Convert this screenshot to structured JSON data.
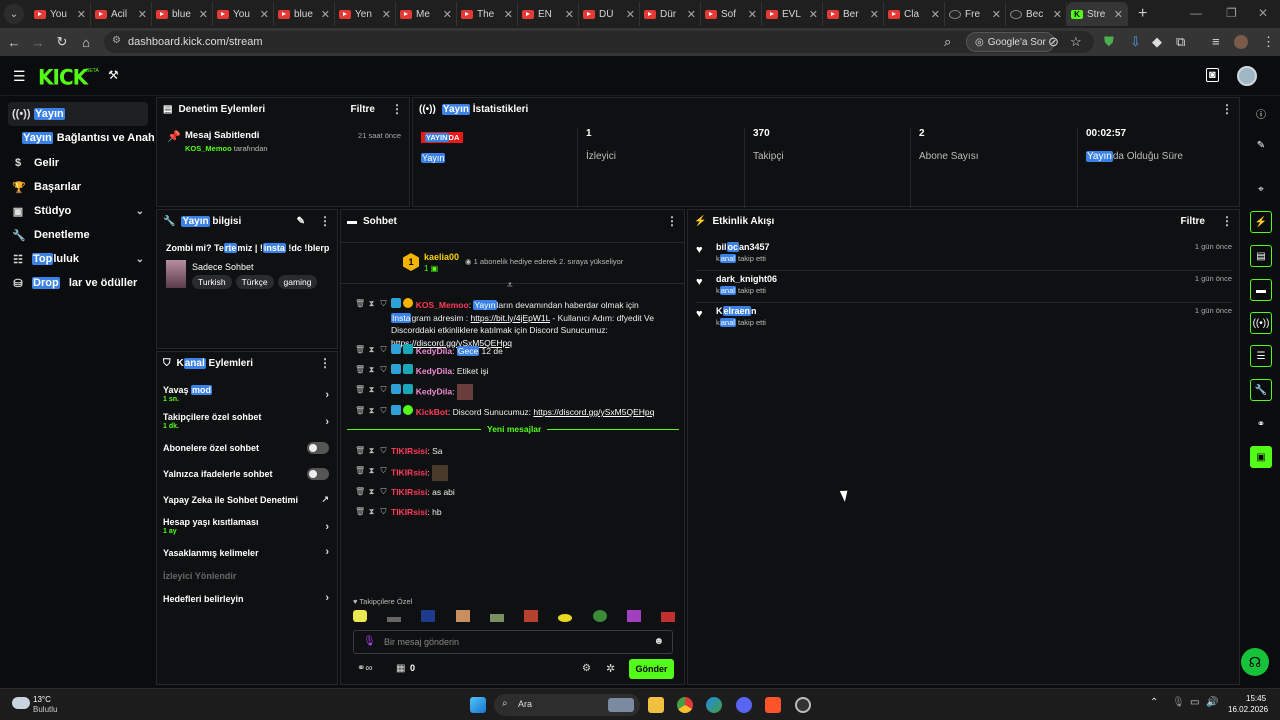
{
  "browser": {
    "tabs": [
      {
        "title": "You",
        "type": "yt"
      },
      {
        "title": "Acil",
        "type": "yt"
      },
      {
        "title": "blue",
        "type": "yt"
      },
      {
        "title": "You",
        "type": "yt"
      },
      {
        "title": "blue",
        "type": "yt"
      },
      {
        "title": "Yen",
        "type": "yt"
      },
      {
        "title": "Me",
        "type": "yt"
      },
      {
        "title": "The",
        "type": "yt"
      },
      {
        "title": "EN",
        "type": "yt"
      },
      {
        "title": "DÜ",
        "type": "yt"
      },
      {
        "title": "Dür",
        "type": "yt"
      },
      {
        "title": "Sof",
        "type": "yt"
      },
      {
        "title": "EVL",
        "type": "yt"
      },
      {
        "title": "Ber",
        "type": "yt"
      },
      {
        "title": "Cla",
        "type": "yt"
      },
      {
        "title": "Fre",
        "type": "dark"
      },
      {
        "title": "Bec",
        "type": "dark"
      },
      {
        "title": "Stre",
        "type": "kick",
        "active": true
      }
    ],
    "url": "dashboard.kick.com/stream",
    "google_sor": "Google'a Sor"
  },
  "kick": {
    "logo": "KICK",
    "beta": "BETA"
  },
  "leftnav": {
    "yayin": "Yayın",
    "baglanti_hl": "Yayın",
    "baglanti_rest": "Bağlantısı ve Anahtar",
    "gelir": "Gelir",
    "basarilar": "Başarılar",
    "studyo": "Stüdyo",
    "denetleme": "Denetleme",
    "topluluk_hl": "Top",
    "topluluk_rest": "luluk",
    "drops_hl": "Drop",
    "drops_rest": "lar ve ödüller"
  },
  "mod_actions": {
    "title": "Denetim Eylemleri",
    "filter": "Filtre",
    "item_title": "Mesaj Sabitlendi",
    "item_user": "KOS_Memoo",
    "item_by": "tarafından",
    "item_time": "21 saat önce"
  },
  "stats": {
    "title_hl": "Yayın",
    "title_rest": " İstatistikleri",
    "live_hl": "YAYIN",
    "live_rest": "DA",
    "yayin_hl": "Yayın",
    "viewers_v": "1",
    "viewers_l": "İzleyici",
    "followers_v": "370",
    "followers_l": "Takipçi",
    "subs_v": "2",
    "subs_l": "Abone Sayısı",
    "uptime_v": "00:02:57",
    "uptime_hl": "Yayın",
    "uptime_rest": "da Olduğu Süre"
  },
  "stream_info": {
    "title_hl": "Yayın",
    "title_rest": " bilgisi",
    "stream_title_a": "Zombi mi? Te",
    "stream_title_hl1": "rte",
    "stream_title_b": "miz | !",
    "stream_title_hl2": "insta",
    "stream_title_c": " !dc !blerp",
    "category": "Sadece Sohbet",
    "tags": [
      "Turkish",
      "Türkçe",
      "gaming"
    ]
  },
  "channel_actions": {
    "title_a": "K",
    "title_hl": "anal",
    "title_b": " Eylemleri",
    "slow_a": "Yavaş ",
    "slow_hl": "mod",
    "slow_sub": "1 sn.",
    "followers_only": "Takipçilere özel sohbet",
    "followers_sub": "1 dk.",
    "subs_only": "Abonelere özel sohbet",
    "emote_only": "Yalnızca ifadelerle sohbet",
    "ai_mod": "Yapay Zeka ile Sohbet Denetimi",
    "age_limit": "Hesap yaşı kısıtlaması",
    "age_sub": "1 ay",
    "banned_words": "Yasaklanmış kelimeler",
    "redirect": "İzleyici Yönlendir",
    "goals": "Hedefleri belirleyin"
  },
  "chat": {
    "title": "Sohbet",
    "top_user": "kaelia00",
    "top_level": "1",
    "top_rank": "1",
    "top_msg": "1 abonelik hediye ederek 2. sıraya yükseliyor",
    "m1_user": "KOS_Memoo",
    "m1_hl1": "Yayın",
    "m1_a": "ların devamından haberdar olmak için",
    "m1_hl2": "Insta",
    "m1_b": "gram adresim : ",
    "m1_link1": "https://bit.ly/4jEpW1L",
    "m1_c": " - Kullanıcı Adım: dfyedit Ve Discorddaki etkinliklere katılmak için Discord Sunucumuz: ",
    "m1_link2": "https://discord.gg/ySxM5QEHpq",
    "m2_user": "KedyDila",
    "m2_hl": "Gece",
    "m2_rest": " 12 de",
    "m3_user": "KedyDila",
    "m3_text": "Etiket işi",
    "m4_user": "KedyDila",
    "m5_user": "KickBot",
    "m5_text": "Discord Sunucumuz: ",
    "m5_link": "https://discord.gg/ySxM5QEHpq",
    "new_messages": "Yeni mesajlar",
    "n1_user": "TIKIRsisi",
    "n1_text": "Sa",
    "n2_user": "TIKIRsisi",
    "n3_user": "TIKIRsisi",
    "n3_text": "as abi",
    "n4_user": "TIKIRsisi",
    "n4_text": "hb",
    "emote_label": "Takipçilere Özel",
    "input_placeholder": "Bir mesaj gönderin",
    "points": "0",
    "send": "Gönder"
  },
  "activity": {
    "title": "Etkinlik Akışı",
    "filter": "Filtre",
    "items": [
      {
        "name_a": "bil",
        "name_hl": "oc",
        "name_b": "an3457",
        "sub_a": "k",
        "sub_hl": "anal",
        "sub_b": " takip etti",
        "time": "1 gün önce"
      },
      {
        "name_a": "dark_knight06",
        "name_hl": "",
        "name_b": "",
        "sub_a": "k",
        "sub_hl": "anal",
        "sub_b": " takip etti",
        "time": "1 gün önce"
      },
      {
        "name_a": "K",
        "name_hl": "elraen",
        "name_b": "n",
        "sub_a": "k",
        "sub_hl": "anal",
        "sub_b": " takip etti",
        "time": "1 gün önce"
      }
    ]
  },
  "taskbar": {
    "weather_temp": "13°C",
    "weather_desc": "Bulutlu",
    "search": "Ara",
    "time": "15:45",
    "date": "16.02.2026"
  },
  "colors": {
    "accent": "#53fc18",
    "highlight": "#3b82e6",
    "live": "#e91916"
  }
}
